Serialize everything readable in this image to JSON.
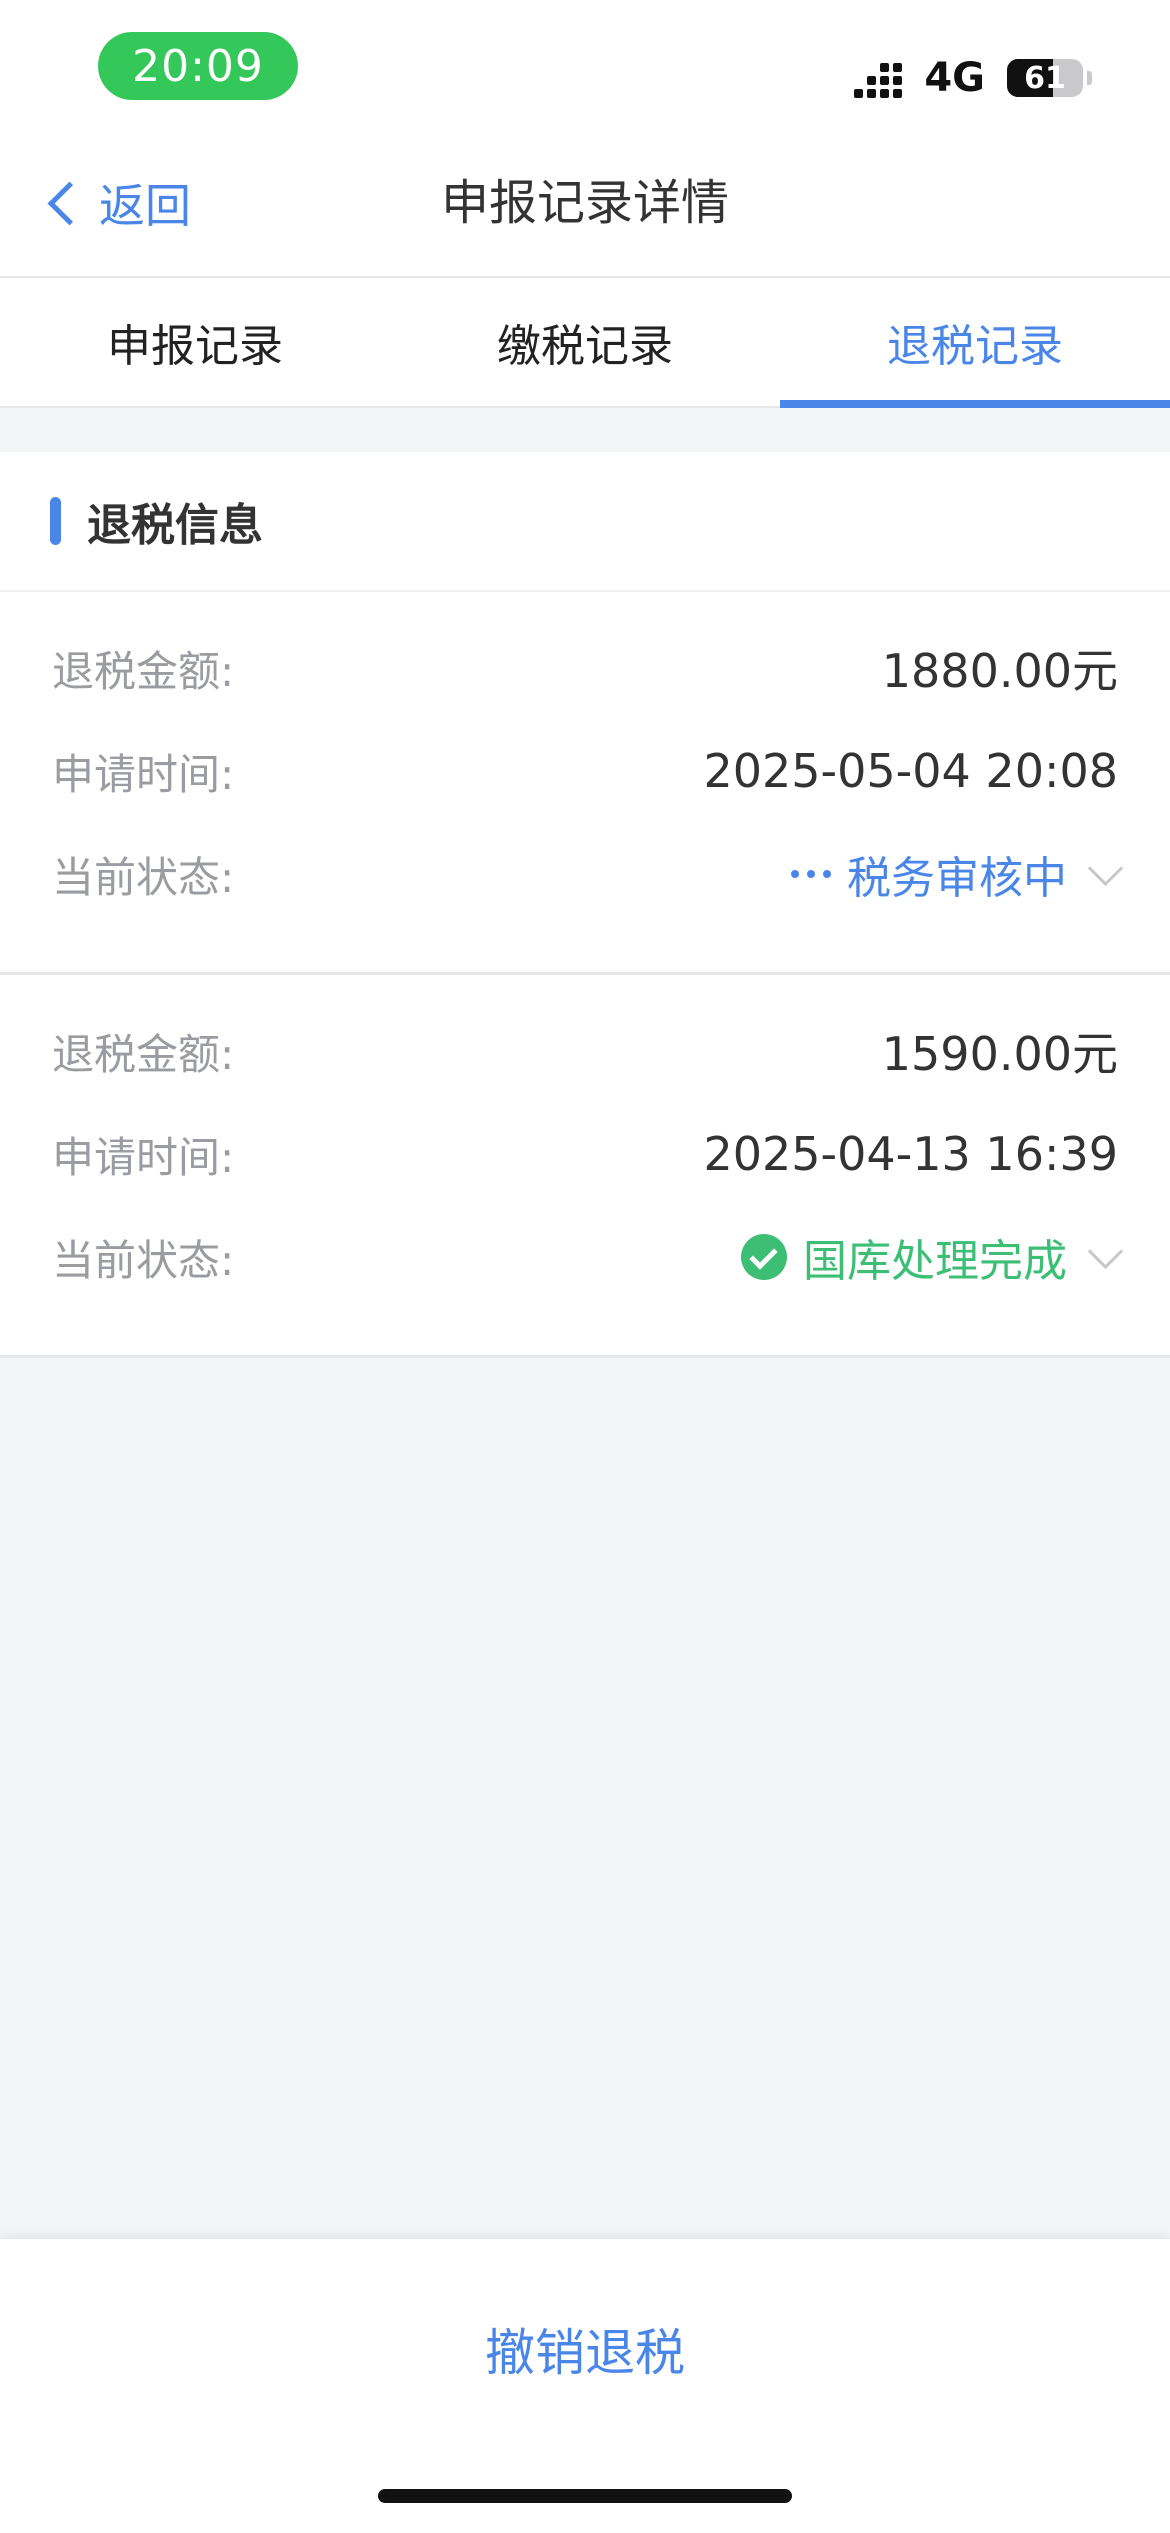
{
  "status_bar": {
    "time": "20:09",
    "network": "4G",
    "battery_percent": "61",
    "battery_level": 0.61
  },
  "nav": {
    "back_label": "返回",
    "title": "申报记录详情"
  },
  "tabs": [
    {
      "label": "申报记录",
      "active": false
    },
    {
      "label": "缴税记录",
      "active": false
    },
    {
      "label": "退税记录",
      "active": true
    }
  ],
  "section": {
    "title": "退税信息"
  },
  "records": [
    {
      "amount_label": "退税金额:",
      "amount": "1880.00元",
      "time_label": "申请时间:",
      "time": "2025-05-04 20:08",
      "status_label": "当前状态:",
      "status": "税务审核中",
      "status_color": "#4a86e8"
    },
    {
      "amount_label": "退税金额:",
      "amount": "1590.00元",
      "time_label": "申请时间:",
      "time": "2025-04-13 16:39",
      "status_label": "当前状态:",
      "status": "国库处理完成",
      "status_color": "#3cbf75"
    }
  ],
  "bottom": {
    "action_label": "撤销退税"
  },
  "colors": {
    "accent": "#4a86e8",
    "success": "#3cbf75",
    "time_pill": "#34c759"
  }
}
